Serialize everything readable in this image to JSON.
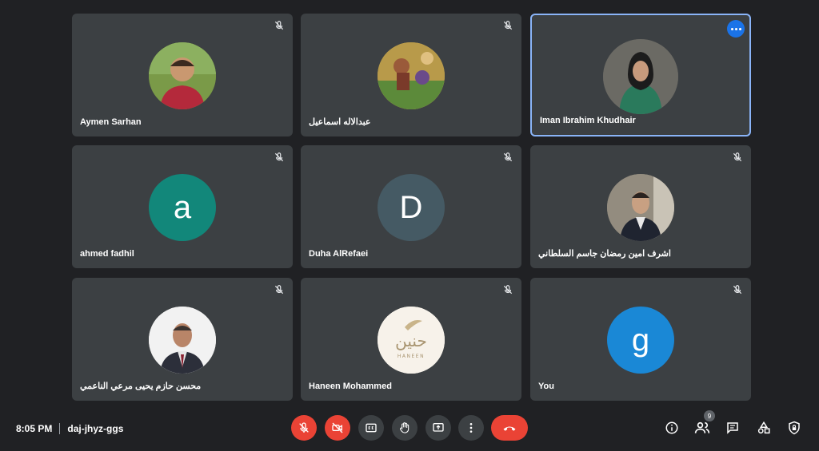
{
  "colors": {
    "background": "#202124",
    "tile": "#3c4043",
    "active_border": "#8ab4f8",
    "danger": "#ea4335"
  },
  "participants": [
    {
      "name": "Aymen Sarhan",
      "avatar_type": "photo",
      "muted": true
    },
    {
      "name": "عبدالاله اسماعيل",
      "avatar_type": "photo",
      "muted": true
    },
    {
      "name": "Iman Ibrahim Khudhair",
      "avatar_type": "photo",
      "muted": false,
      "speaking": true
    },
    {
      "name": "ahmed fadhil",
      "avatar_type": "letter",
      "letter": "a",
      "avatar_color": "#12877a",
      "muted": true
    },
    {
      "name": "Duha AlRefaei",
      "avatar_type": "letter",
      "letter": "D",
      "avatar_color": "#455a64",
      "muted": true
    },
    {
      "name": "اشرف امين رمضان جاسم السلطاني",
      "avatar_type": "photo",
      "muted": true
    },
    {
      "name": "محسن حازم يحيى مرعي الناعمي",
      "avatar_type": "photo",
      "muted": true
    },
    {
      "name": "Haneen Mohammed",
      "avatar_type": "logo",
      "muted": true
    },
    {
      "name": "You",
      "avatar_type": "letter",
      "letter": "g",
      "avatar_color": "#1a88d6",
      "muted": true
    }
  ],
  "meeting": {
    "time": "8:05 PM",
    "code": "daj-jhyz-ggs"
  },
  "controls": {
    "people_count": "9"
  },
  "haneen_logo": {
    "arabic": "حنين",
    "latin": "HANEEN"
  }
}
